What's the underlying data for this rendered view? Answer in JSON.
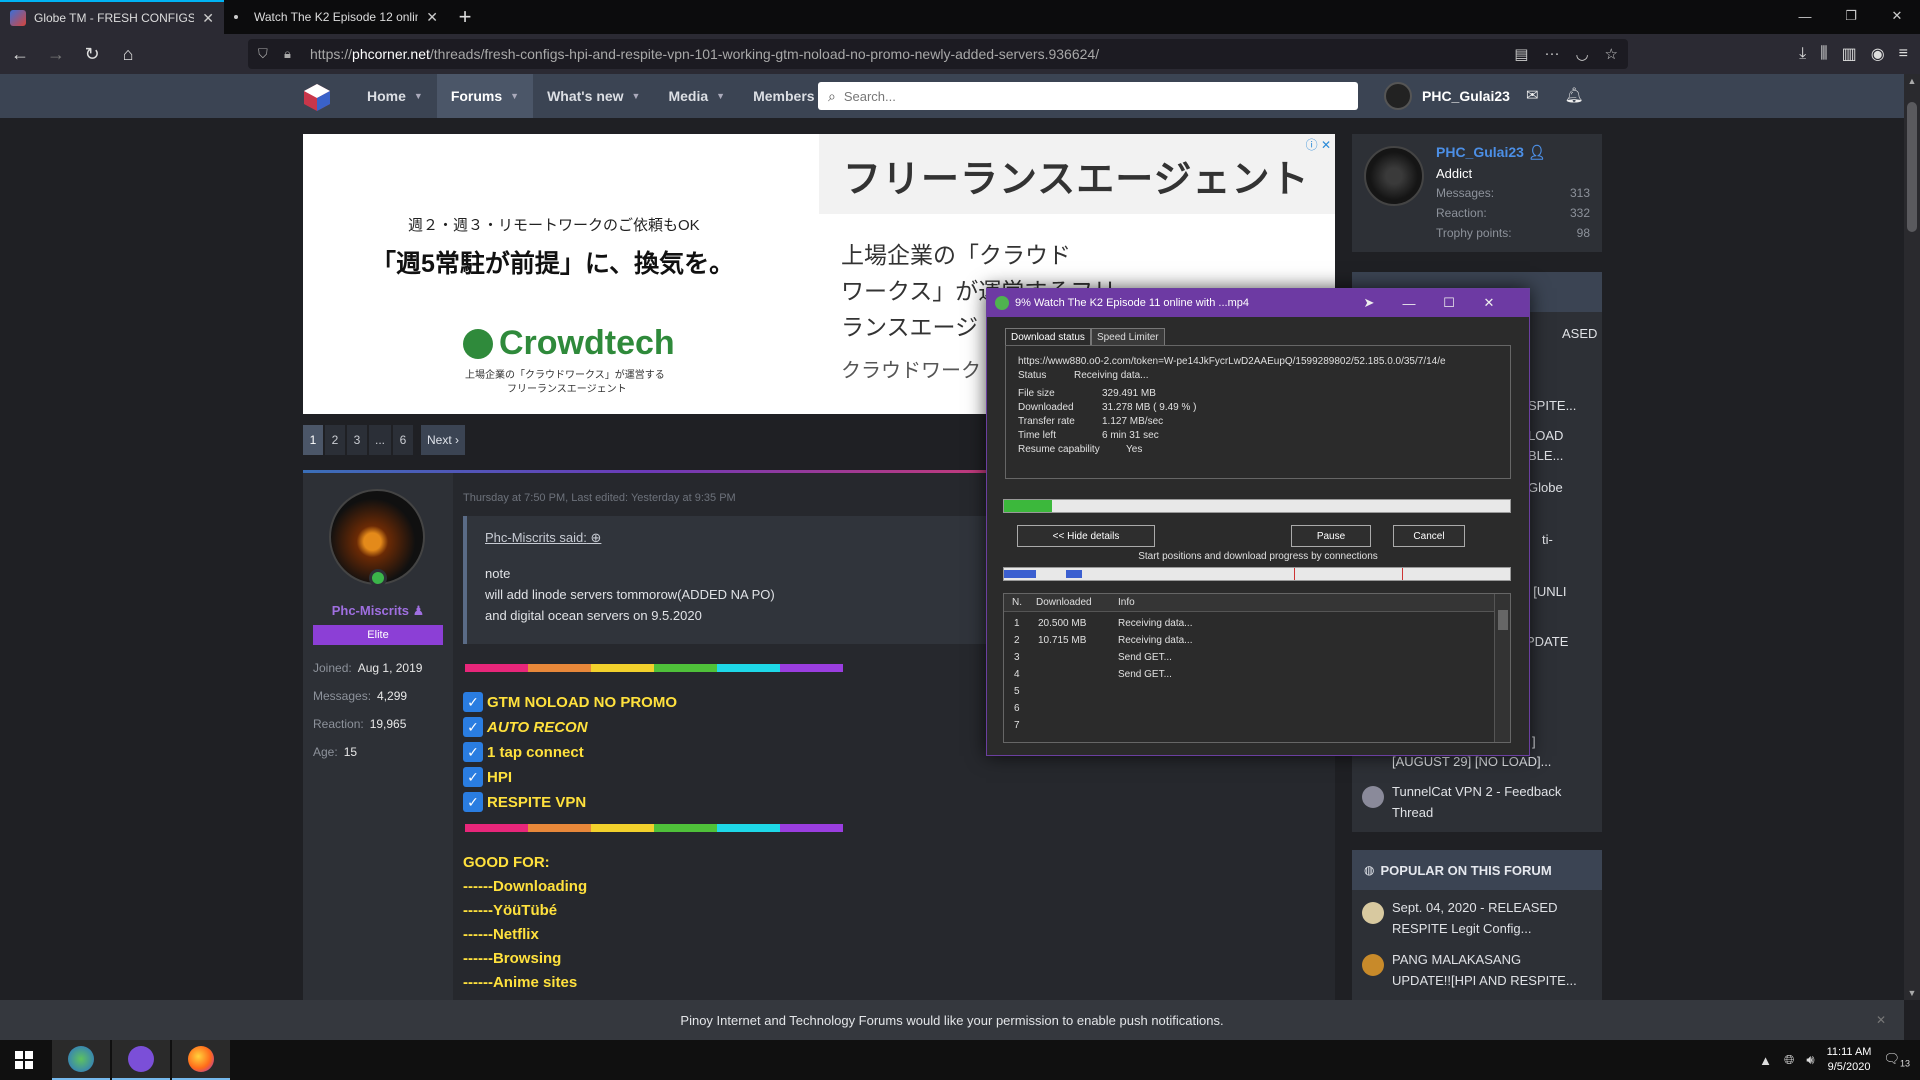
{
  "browser": {
    "tabs": [
      {
        "title": "Globe TM - FRESH CONFIGS-",
        "active": true
      },
      {
        "title": "Watch The K2 Episode 12 onlin",
        "active": false
      }
    ],
    "new_tab": "+",
    "url_prefix": "https://",
    "url_host": "phcorner.net",
    "url_path": "/threads/fresh-configs-hpi-and-respite-vpn-101-working-gtm-noload-no-promo-newly-added-servers.936624/"
  },
  "site": {
    "nav": [
      {
        "label": "Home",
        "selected": false
      },
      {
        "label": "Forums",
        "selected": true
      },
      {
        "label": "What's new",
        "selected": false
      },
      {
        "label": "Media",
        "selected": false
      },
      {
        "label": "Members",
        "selected": false
      }
    ],
    "search_placeholder": "Search...",
    "username": "PHC_Gulai23"
  },
  "ad": {
    "line1": "週２・週３・リモートワークのご依頼もOK",
    "line2": "「週5常駐が前提」に、換気を。",
    "brand": "Crowdtech",
    "brand_sub1": "上場企業の「クラウドワークス」が運営する",
    "brand_sub2": "フリーランスエージェント",
    "headline": "フリーランスエージェント",
    "body1": "上場企業の「クラウド",
    "body2": "ワークス」が運営するフリ",
    "body3": "ランスエージ",
    "body4": "クラウドワーク"
  },
  "pager": {
    "pages": [
      "1",
      "2",
      "3",
      "...",
      "6"
    ],
    "next": "Next ›"
  },
  "post": {
    "meta": "Thursday at 7:50 PM, Last edited: Yesterday at 9:35 PM",
    "author": {
      "name": "Phc-Miscrits",
      "role": "Elite",
      "stats": [
        {
          "label": "Joined:",
          "value": "Aug 1, 2019"
        },
        {
          "label": "Messages:",
          "value": "4,299"
        },
        {
          "label": "Reaction:",
          "value": "19,965"
        },
        {
          "label": "Age:",
          "value": "15"
        }
      ]
    },
    "quote": {
      "head": "Phc-Miscrits said:",
      "lines": [
        "note",
        "will add linode servers tommorow(ADDED NA PO)",
        "and digital ocean servers on 9.5.2020"
      ]
    },
    "rainbow_colors": [
      "#e8267a",
      "#e8883a",
      "#f2d12c",
      "#4fc13a",
      "#1ed8e8",
      "#9a3ee0"
    ],
    "checks": [
      {
        "text": "GTM NOLOAD NO PROMO",
        "italic": false
      },
      {
        "text": "AUTO RECON",
        "italic": true
      },
      {
        "text": "1 tap connect",
        "italic": false
      },
      {
        "text": "HPI",
        "italic": false
      },
      {
        "text": "RESPITE VPN",
        "italic": false
      }
    ],
    "good_for": [
      "GOOD FOR:",
      "------Downloading",
      "------YöüTübé",
      "------Netflix",
      "------Browsing",
      "------Anime sites"
    ]
  },
  "sidebar": {
    "profile": {
      "name": "PHC_Gulai23",
      "title": "Addict",
      "stats": [
        {
          "label": "Messages:",
          "value": "313"
        },
        {
          "label": "Reaction:",
          "value": "332"
        },
        {
          "label": "Trophy points:",
          "value": "98"
        }
      ]
    },
    "partial_items": [
      "ASED",
      "SPITE...",
      "LOAD",
      "BLE...",
      "Globe",
      "ti-",
      "] [UNLI",
      "PDATE",
      "]",
      "[AUGUST 29] [NO LOAD]..."
    ],
    "latest_item": {
      "line1": "TunnelCat VPN 2 - Feedback",
      "line2": "Thread"
    },
    "popular": {
      "title": "POPULAR ON THIS FORUM",
      "items": [
        {
          "line1": "Sept. 04, 2020 - RELEASED",
          "line2": "RESPITE Legit Config..."
        },
        {
          "line1": "PANG MALAKASANG",
          "line2": "UPDATE!![HPI AND RESPITE..."
        }
      ]
    }
  },
  "notification": "Pinoy Internet and Technology Forums would like your permission to enable push notifications.",
  "idm": {
    "title": "9% Watch The K2 Episode 11 online with ...mp4",
    "tabs": [
      "Download status",
      "Speed Limiter"
    ],
    "url": "https://www880.o0-2.com/token=W-pe14JkFycrLwD2AAEupQ/1599289802/52.185.0.0/35/7/14/e",
    "status_label": "Status",
    "status_value": "Receiving data...",
    "fields": [
      {
        "label": "File size",
        "value": "329.491  MB"
      },
      {
        "label": "Downloaded",
        "value": "31.278  MB  ( 9.49 % )"
      },
      {
        "label": "Transfer rate",
        "value": "1.127  MB/sec"
      },
      {
        "label": "Time left",
        "value": "6 min 31 sec"
      }
    ],
    "resume_label": "Resume capability",
    "resume_value": "Yes",
    "progress_percent": 9.49,
    "buttons": {
      "hide": "<< Hide details",
      "pause": "Pause",
      "cancel": "Cancel"
    },
    "conn_label": "Start positions and download progress by connections",
    "columns": [
      "N.",
      "Downloaded",
      "Info"
    ],
    "rows": [
      {
        "n": "1",
        "downloaded": "20.500  MB",
        "info": "Receiving data..."
      },
      {
        "n": "2",
        "downloaded": "10.715  MB",
        "info": "Receiving data..."
      },
      {
        "n": "3",
        "downloaded": "",
        "info": "Send GET..."
      },
      {
        "n": "4",
        "downloaded": "",
        "info": "Send GET..."
      },
      {
        "n": "5",
        "downloaded": "",
        "info": ""
      },
      {
        "n": "6",
        "downloaded": "",
        "info": ""
      },
      {
        "n": "7",
        "downloaded": "",
        "info": ""
      }
    ]
  },
  "taskbar": {
    "time": "11:11 AM",
    "date": "9/5/2020",
    "notif_count": "13"
  }
}
